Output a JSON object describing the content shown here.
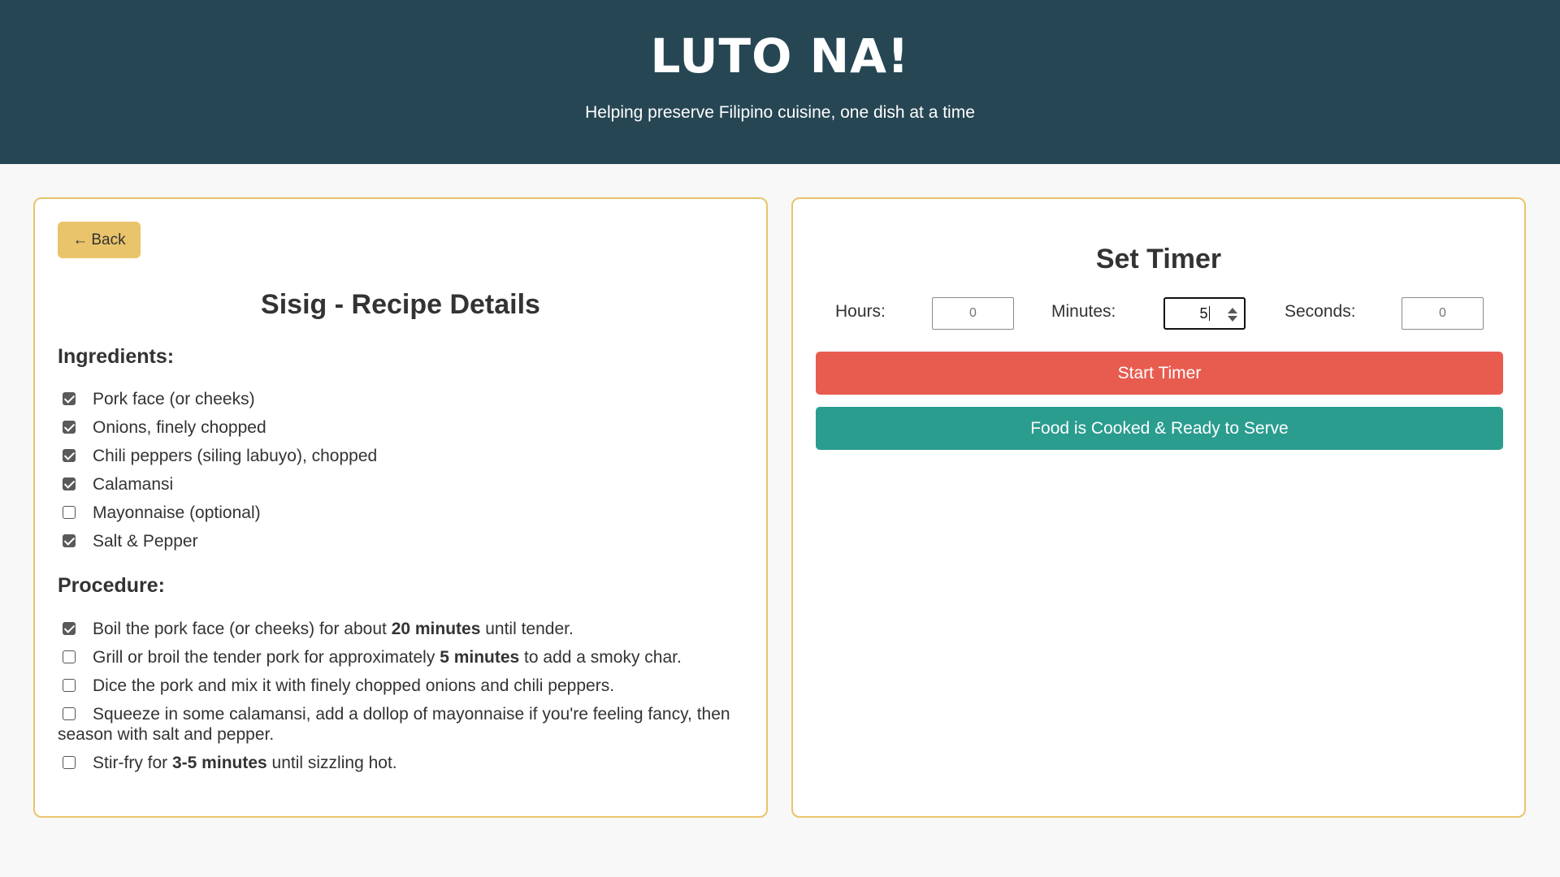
{
  "header": {
    "title": "LUTO NA!",
    "tagline": "Helping preserve Filipino cuisine, one dish at a time"
  },
  "recipe": {
    "back_label": "Back",
    "back_icon": "left-arrow-icon",
    "title": "Sisig - Recipe Details",
    "ingredients_heading": "Ingredients:",
    "ingredients": [
      {
        "text": "Pork face (or cheeks)",
        "checked": true
      },
      {
        "text": "Onions, finely chopped",
        "checked": true
      },
      {
        "text": "Chili peppers (siling labuyo), chopped",
        "checked": true
      },
      {
        "text": "Calamansi",
        "checked": true
      },
      {
        "text": "Mayonnaise (optional)",
        "checked": false
      },
      {
        "text": "Salt & Pepper",
        "checked": true
      }
    ],
    "procedure_heading": "Procedure:",
    "procedure": [
      {
        "before": "Boil the pork face (or cheeks) for about ",
        "bold": "20 minutes",
        "after": " until tender.",
        "checked": true
      },
      {
        "before": "Grill or broil the tender pork for approximately ",
        "bold": "5 minutes",
        "after": " to add a smoky char.",
        "checked": false
      },
      {
        "before": "Dice the pork and mix it with finely chopped onions and chili peppers.",
        "bold": "",
        "after": "",
        "checked": false
      },
      {
        "before": "Squeeze in some calamansi, add a dollop of mayonnaise if you're feeling fancy, then season with salt and pepper.",
        "bold": "",
        "after": "",
        "checked": false
      },
      {
        "before": "Stir-fry for ",
        "bold": "3-5 minutes",
        "after": " until sizzling hot.",
        "checked": false
      }
    ]
  },
  "timer": {
    "title": "Set Timer",
    "hours_label": "Hours:",
    "minutes_label": "Minutes:",
    "seconds_label": "Seconds:",
    "hours_placeholder": "0",
    "minutes_value": "5",
    "seconds_placeholder": "0",
    "start_label": "Start Timer",
    "served_label": "Food is Cooked & Ready to Serve"
  },
  "colors": {
    "header_bg": "#264653",
    "accent_yellow": "#e9c46a",
    "start_red": "#e85c50",
    "served_teal": "#2a9d8f"
  }
}
